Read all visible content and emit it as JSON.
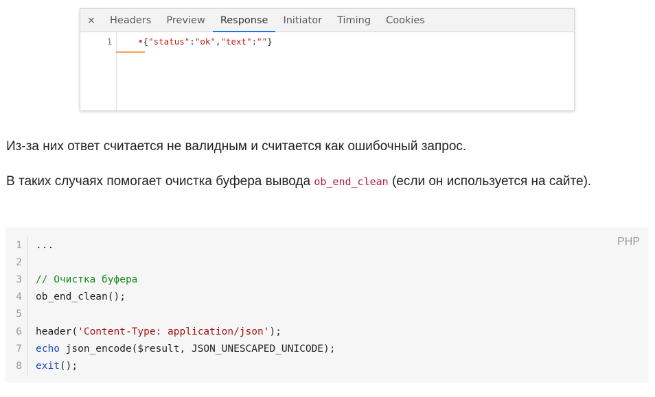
{
  "devtools": {
    "close_glyph": "×",
    "tabs": [
      "Headers",
      "Preview",
      "Response",
      "Initiator",
      "Timing",
      "Cookies"
    ],
    "active_tab": "Response",
    "line_number": "1",
    "response_prefix": "{",
    "response_parts": [
      "\"status\"",
      ":",
      "\"ok\"",
      ",",
      "\"text\"",
      ":",
      "\"\"",
      "}"
    ]
  },
  "paragraph1": "Из-за них ответ считается не валидным и считается как ошибочный запрос.",
  "paragraph2": {
    "before": "В таких случаях помогает очистка буфера вывода ",
    "code": "ob_end_clean",
    "after": " (если он используется на сайте)."
  },
  "code_block": {
    "language": "PHP",
    "lines": [
      {
        "n": "1",
        "text": "..."
      },
      {
        "n": "2",
        "text": ""
      },
      {
        "n": "3",
        "text": "// Очистка буфера"
      },
      {
        "n": "4",
        "text": "ob_end_clean();"
      },
      {
        "n": "5",
        "text": ""
      },
      {
        "n": "6",
        "text": "header('Content-Type: application/json');"
      },
      {
        "n": "7",
        "text": "echo json_encode($result, JSON_UNESCAPED_UNICODE);"
      },
      {
        "n": "8",
        "text": "exit();"
      }
    ]
  }
}
